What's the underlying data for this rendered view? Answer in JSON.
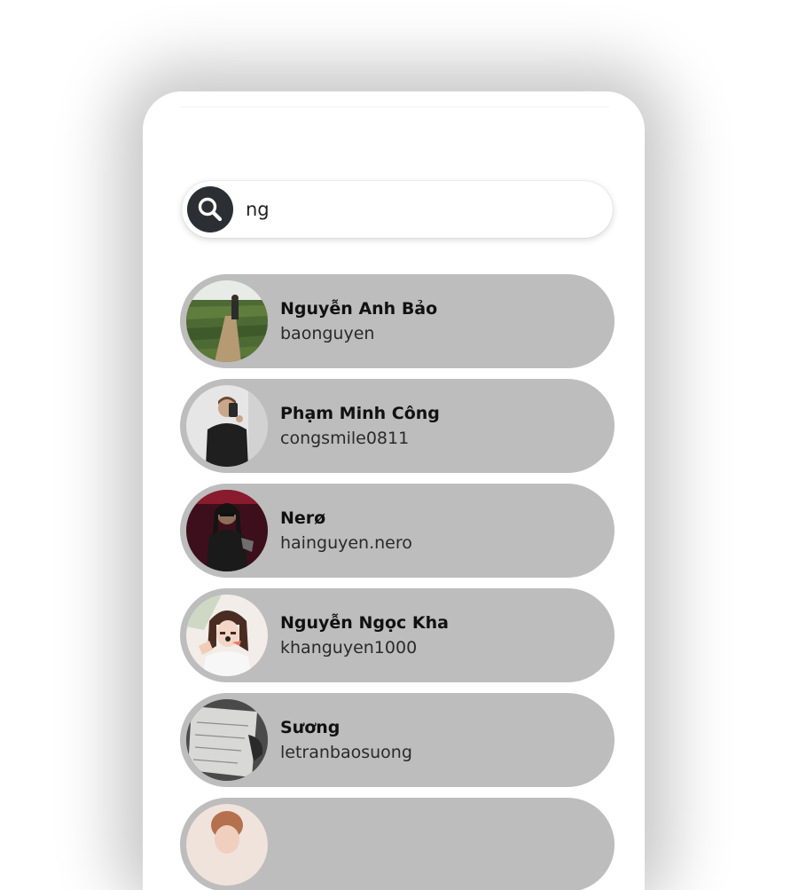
{
  "search": {
    "value": "ng",
    "icon": "search-icon"
  },
  "users": [
    {
      "name": "Nguyễn Anh Bảo",
      "handle": "baonguyen",
      "avatar": "photo-field-path"
    },
    {
      "name": "Phạm Minh Công",
      "handle": "congsmile0811",
      "avatar": "photo-mirror-selfie"
    },
    {
      "name": "Nerø",
      "handle": "hainguyen.nero",
      "avatar": "photo-character-red"
    },
    {
      "name": "Nguyễn Ngọc Kha",
      "handle": "khanguyen1000",
      "avatar": "photo-girl-selfie"
    },
    {
      "name": "Sương",
      "handle": "letranbaosuong",
      "avatar": "photo-notebook"
    },
    {
      "name": "",
      "handle": "",
      "avatar": "photo-partial"
    }
  ],
  "colors": {
    "item_background": "#bdbdbd",
    "search_icon_background": "#2b2f33",
    "page_background": "#ffffff"
  }
}
